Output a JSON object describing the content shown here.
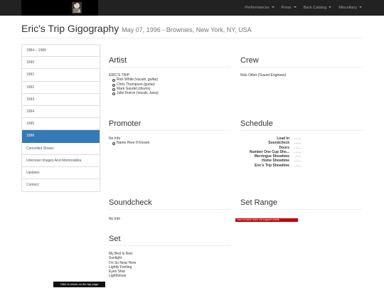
{
  "navbar": {
    "menu": [
      {
        "label": "Performances"
      },
      {
        "label": "Press"
      },
      {
        "label": "Back Catalog"
      },
      {
        "label": "Miscellany"
      }
    ]
  },
  "header": {
    "title": "Eric's Trip Gigography",
    "subtitle": "May 07, 1996 - Brownies, New York, NY, USA"
  },
  "sidebar": {
    "items": [
      {
        "label": "1984 – 1989"
      },
      {
        "label": "1990"
      },
      {
        "label": "1991"
      },
      {
        "label": "1992"
      },
      {
        "label": "1993"
      },
      {
        "label": "1994"
      },
      {
        "label": "1995"
      },
      {
        "label": "1996"
      },
      {
        "label": "Cancelled Shows"
      },
      {
        "label": "Unknown Images And Memorabilia"
      },
      {
        "label": "Updates"
      },
      {
        "label": "Contact"
      }
    ]
  },
  "artist": {
    "title": "Artist",
    "band": "ERIC'S TRIP",
    "members": [
      {
        "name": "Rick White",
        "role": "(vocals, guitar)"
      },
      {
        "name": "Chris Thompson",
        "role": "(guitar)"
      },
      {
        "name": "Mark Gaudet",
        "role": "(drums)"
      },
      {
        "name": "Julie Doiron",
        "role": "(vocals, bass)"
      }
    ]
  },
  "crew": {
    "title": "Crew",
    "name": "Nick Other",
    "role": "(Sound Engineer)"
  },
  "promoter": {
    "title": "Promoter",
    "info": "No Info",
    "item": "Name Here If Known"
  },
  "schedule": {
    "title": "Schedule",
    "rows": [
      {
        "label": "Load In",
        "value": "...:..."
      },
      {
        "label": "Soundcheck",
        "value": "...:..."
      },
      {
        "label": "Doors",
        "value": "...:..."
      },
      {
        "label": "Number One Cup Sho...",
        "value": "...:..."
      },
      {
        "label": "Merringue Showtime",
        "value": "...:..."
      },
      {
        "label": "Home Showtime",
        "value": "...:..."
      },
      {
        "label": "Eric's Trip Showtime",
        "value": "...:..."
      }
    ]
  },
  "soundcheck": {
    "title": "Soundcheck",
    "info": "No Info"
  },
  "set_range": {
    "title": "Set Range",
    "chart_message": "Your browser does not support charts."
  },
  "setlist": {
    "title": "Set",
    "songs": [
      "My Bed Is Red",
      "Sunlight",
      "I'm So Near Here",
      "Lightly Feeling",
      "Eyes Shut",
      "Lighthouse"
    ]
  },
  "back_to_top": "Click to return on the top page",
  "colors": {
    "navbar": "#222222",
    "active": "#337ab7",
    "chart_error": "#c00000"
  }
}
